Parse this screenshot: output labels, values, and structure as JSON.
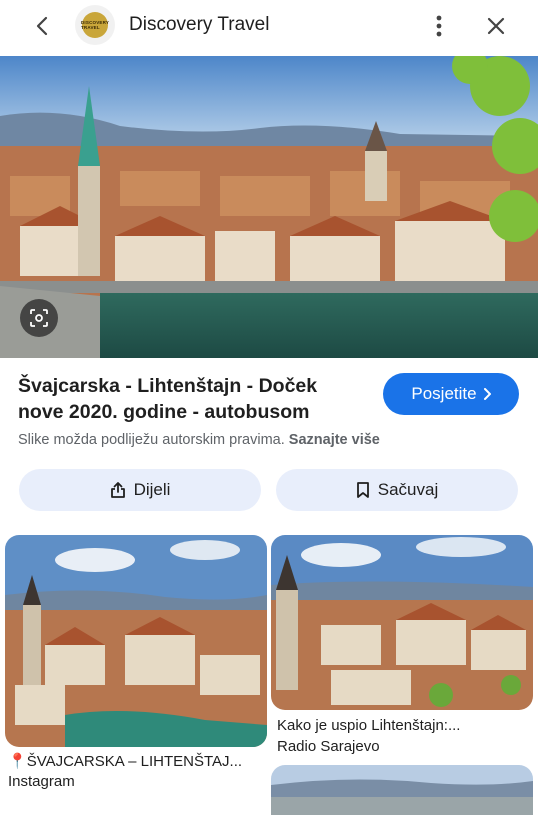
{
  "header": {
    "site_name": "Discovery Travel",
    "logo_text": "DISCOVERY TRAVEL",
    "back_icon": "chevron-left-icon",
    "more_icon": "more-vertical-icon",
    "close_icon": "close-icon"
  },
  "result": {
    "title": "Švajcarska - Lihtenštajn - Doček nove 2020. godine - autobusom",
    "visit_label": "Posjetite",
    "copyright_text": "Slike možda podliježu autorskim pravima.",
    "learn_more": "Saznajte više",
    "share_label": "Dijeli",
    "save_label": "Sačuvaj"
  },
  "related": [
    {
      "caption": "ŠVAJCARSKA – LIHTENŠTAJ...",
      "source": "Instagram"
    },
    {
      "caption": "Kako je uspio Lihtenštajn:...",
      "source": "Radio Sarajevo"
    }
  ],
  "colors": {
    "accent": "#1a73e8",
    "pill_bg": "#e8eefb"
  }
}
